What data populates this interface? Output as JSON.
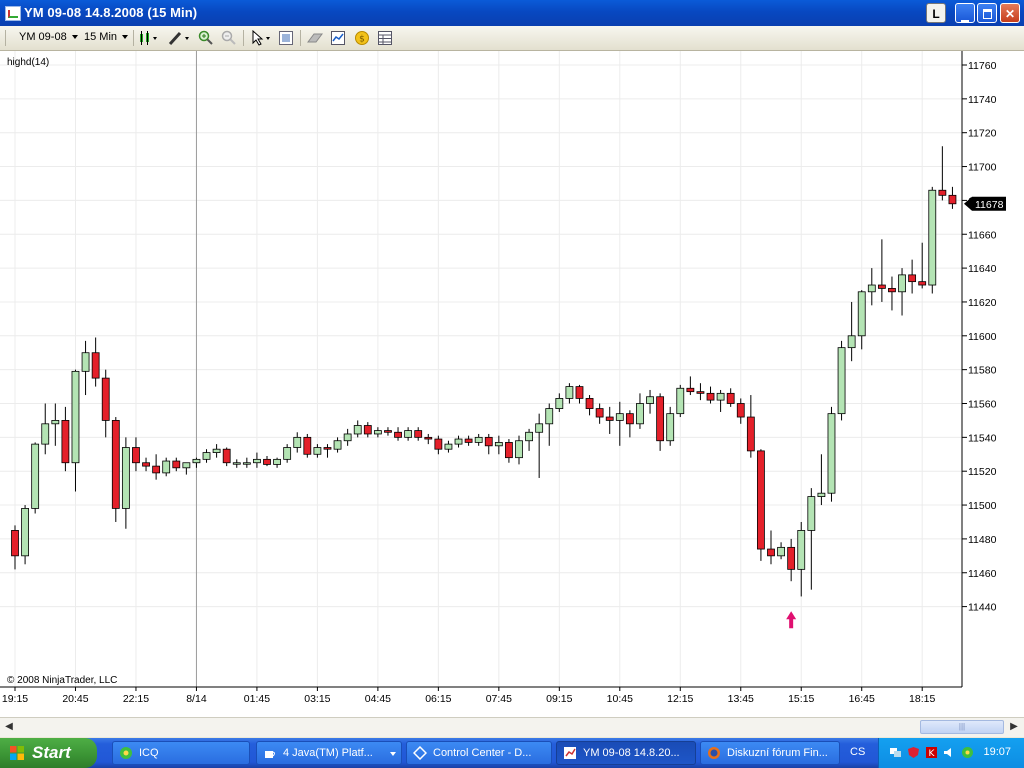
{
  "window": {
    "title": "YM 09-08  14.8.2008 (15 Min)",
    "btn_l": "L"
  },
  "toolbar": {
    "instrument": "YM 09-08",
    "interval": "15 Min"
  },
  "chart": {
    "indicator_label": "highd(14)",
    "copyright": "© 2008 NinjaTrader, LLC",
    "last_price": "11678",
    "colors": {
      "up": "#b4e4b4",
      "down": "#e4202a",
      "grid": "#ececec",
      "marker": "#e01070"
    }
  },
  "chart_data": {
    "type": "candlestick",
    "ylim": [
      11420,
      11770
    ],
    "y_ticks": [
      11440,
      11460,
      11480,
      11500,
      11520,
      11540,
      11560,
      11580,
      11600,
      11620,
      11640,
      11660,
      11680,
      11700,
      11720,
      11740,
      11760
    ],
    "x_ticks": [
      "19:15",
      "20:45",
      "22:15",
      "8/14",
      "01:45",
      "03:15",
      "04:45",
      "06:15",
      "07:45",
      "09:15",
      "10:45",
      "12:15",
      "13:45",
      "15:15",
      "16:45",
      "18:15"
    ],
    "candles": [
      [
        11485,
        11488,
        11462,
        11470
      ],
      [
        11470,
        11500,
        11465,
        11498
      ],
      [
        11498,
        11537,
        11495,
        11536
      ],
      [
        11536,
        11560,
        11530,
        11548
      ],
      [
        11548,
        11560,
        11535,
        11550
      ],
      [
        11550,
        11558,
        11520,
        11525
      ],
      [
        11525,
        11580,
        11508,
        11579
      ],
      [
        11579,
        11597,
        11565,
        11590
      ],
      [
        11590,
        11599,
        11570,
        11575
      ],
      [
        11575,
        11580,
        11540,
        11550
      ],
      [
        11550,
        11552,
        11490,
        11498
      ],
      [
        11498,
        11540,
        11486,
        11534
      ],
      [
        11534,
        11540,
        11520,
        11525
      ],
      [
        11525,
        11528,
        11520,
        11523
      ],
      [
        11523,
        11530,
        11515,
        11519
      ],
      [
        11519,
        11528,
        11517,
        11526
      ],
      [
        11526,
        11528,
        11520,
        11522
      ],
      [
        11522,
        11525,
        11518,
        11525
      ],
      [
        11525,
        11528,
        11522,
        11527
      ],
      [
        11527,
        11533,
        11525,
        11531
      ],
      [
        11531,
        11536,
        11528,
        11533
      ],
      [
        11533,
        11534,
        11523,
        11525
      ],
      [
        11525,
        11527,
        11522,
        11525
      ],
      [
        11525,
        11528,
        11522,
        11525
      ],
      [
        11525,
        11531,
        11522,
        11527
      ],
      [
        11527,
        11529,
        11523,
        11524
      ],
      [
        11524,
        11528,
        11522,
        11527
      ],
      [
        11527,
        11536,
        11525,
        11534
      ],
      [
        11534,
        11543,
        11531,
        11540
      ],
      [
        11540,
        11542,
        11528,
        11530
      ],
      [
        11530,
        11536,
        11528,
        11534
      ],
      [
        11534,
        11536,
        11528,
        11533
      ],
      [
        11533,
        11540,
        11531,
        11538
      ],
      [
        11538,
        11545,
        11535,
        11542
      ],
      [
        11542,
        11550,
        11540,
        11547
      ],
      [
        11547,
        11549,
        11540,
        11542
      ],
      [
        11542,
        11546,
        11540,
        11544
      ],
      [
        11544,
        11546,
        11541,
        11543
      ],
      [
        11543,
        11546,
        11538,
        11540
      ],
      [
        11540,
        11546,
        11538,
        11544
      ],
      [
        11544,
        11546,
        11538,
        11540
      ],
      [
        11540,
        11542,
        11536,
        11539
      ],
      [
        11539,
        11541,
        11530,
        11533
      ],
      [
        11533,
        11538,
        11531,
        11536
      ],
      [
        11536,
        11541,
        11534,
        11539
      ],
      [
        11539,
        11541,
        11535,
        11537
      ],
      [
        11537,
        11542,
        11535,
        11540
      ],
      [
        11540,
        11542,
        11530,
        11535
      ],
      [
        11535,
        11541,
        11530,
        11537
      ],
      [
        11537,
        11539,
        11525,
        11528
      ],
      [
        11528,
        11541,
        11524,
        11538
      ],
      [
        11538,
        11545,
        11532,
        11543
      ],
      [
        11543,
        11554,
        11516,
        11548
      ],
      [
        11548,
        11560,
        11535,
        11557
      ],
      [
        11557,
        11566,
        11555,
        11563
      ],
      [
        11563,
        11572,
        11560,
        11570
      ],
      [
        11570,
        11571,
        11560,
        11563
      ],
      [
        11563,
        11565,
        11553,
        11557
      ],
      [
        11557,
        11560,
        11548,
        11552
      ],
      [
        11552,
        11558,
        11542,
        11550
      ],
      [
        11550,
        11561,
        11535,
        11554
      ],
      [
        11554,
        11556,
        11540,
        11548
      ],
      [
        11548,
        11566,
        11545,
        11560
      ],
      [
        11560,
        11568,
        11554,
        11564
      ],
      [
        11564,
        11566,
        11532,
        11538
      ],
      [
        11538,
        11558,
        11535,
        11554
      ],
      [
        11554,
        11571,
        11552,
        11569
      ],
      [
        11569,
        11576,
        11565,
        11567
      ],
      [
        11567,
        11572,
        11562,
        11566
      ],
      [
        11566,
        11570,
        11560,
        11562
      ],
      [
        11562,
        11568,
        11555,
        11566
      ],
      [
        11566,
        11569,
        11558,
        11560
      ],
      [
        11560,
        11563,
        11548,
        11552
      ],
      [
        11552,
        11565,
        11528,
        11532
      ],
      [
        11532,
        11533,
        11467,
        11474
      ],
      [
        11474,
        11485,
        11465,
        11470
      ],
      [
        11470,
        11478,
        11468,
        11475
      ],
      [
        11475,
        11480,
        11455,
        11462
      ],
      [
        11462,
        11490,
        11446,
        11485
      ],
      [
        11485,
        11510,
        11450,
        11505
      ],
      [
        11505,
        11530,
        11500,
        11507
      ],
      [
        11507,
        11558,
        11502,
        11554
      ],
      [
        11554,
        11597,
        11550,
        11593
      ],
      [
        11593,
        11620,
        11585,
        11600
      ],
      [
        11600,
        11627,
        11592,
        11626
      ],
      [
        11626,
        11640,
        11618,
        11630
      ],
      [
        11630,
        11657,
        11620,
        11628
      ],
      [
        11628,
        11635,
        11615,
        11626
      ],
      [
        11626,
        11640,
        11612,
        11636
      ],
      [
        11636,
        11645,
        11625,
        11632
      ],
      [
        11632,
        11655,
        11628,
        11630
      ],
      [
        11630,
        11688,
        11625,
        11686
      ],
      [
        11686,
        11712,
        11680,
        11683
      ],
      [
        11683,
        11688,
        11675,
        11678
      ]
    ],
    "marker_at_index": 77
  },
  "taskbar": {
    "start": "Start",
    "tasks": [
      {
        "label": "ICQ"
      },
      {
        "label": "4 Java(TM) Platf..."
      },
      {
        "label": "Control Center - D..."
      },
      {
        "label": "YM 09-08  14.8.20..."
      },
      {
        "label": "Diskuzní fórum Fin..."
      }
    ],
    "lang": "CS",
    "clock": "19:07"
  }
}
